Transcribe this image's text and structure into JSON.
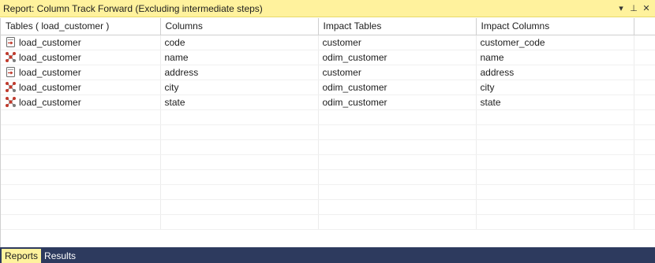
{
  "window": {
    "title": "Report: Column Track Forward (Excluding intermediate steps)",
    "dropdown_glyph": "▾",
    "pin_glyph": "⊥",
    "close_glyph": "✕"
  },
  "columns": [
    "Tables ( load_customer )",
    "Columns",
    "Impact Tables",
    "Impact Columns"
  ],
  "rows": [
    {
      "icon": "load-table-icon",
      "table": "load_customer",
      "column": "code",
      "impact_table": "customer",
      "impact_column": "customer_code"
    },
    {
      "icon": "dimension-table-icon",
      "table": "load_customer",
      "column": "name",
      "impact_table": "odim_customer",
      "impact_column": "name"
    },
    {
      "icon": "load-table-icon",
      "table": "load_customer",
      "column": "address",
      "impact_table": "customer",
      "impact_column": "address"
    },
    {
      "icon": "dimension-table-icon",
      "table": "load_customer",
      "column": "city",
      "impact_table": "odim_customer",
      "impact_column": "city"
    },
    {
      "icon": "dimension-table-icon",
      "table": "load_customer",
      "column": "state",
      "impact_table": "odim_customer",
      "impact_column": "state"
    }
  ],
  "empty_row_count": 8,
  "tabs": [
    {
      "label": "Reports",
      "active": true
    },
    {
      "label": "Results",
      "active": false
    }
  ],
  "colors": {
    "title_bar": "#fff29d",
    "tab_bar": "#2d3a5e",
    "active_tab": "#fff29d"
  }
}
